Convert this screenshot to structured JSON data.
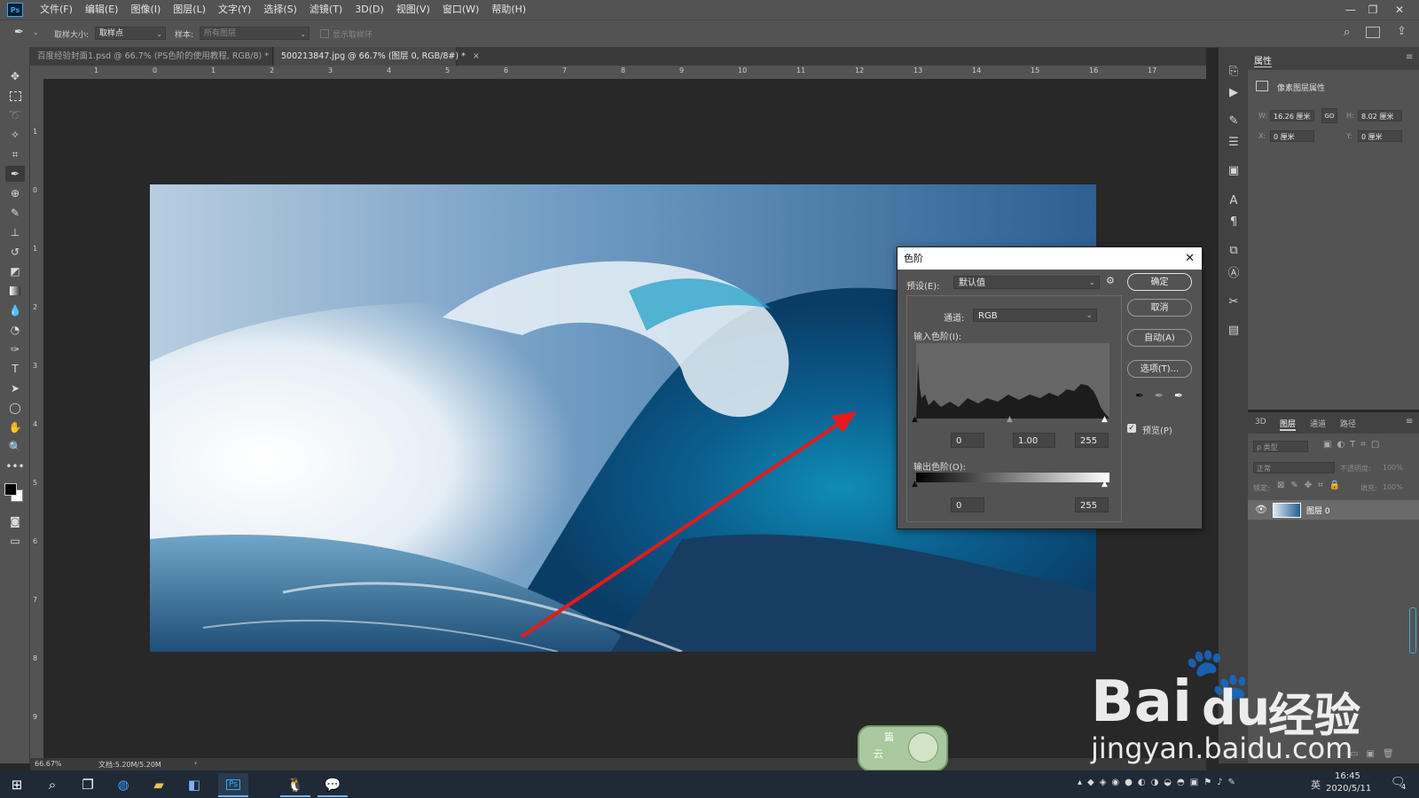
{
  "app": {
    "logo": "Ps"
  },
  "menubar": {
    "items": [
      "文件(F)",
      "编辑(E)",
      "图像(I)",
      "图层(L)",
      "文字(Y)",
      "选择(S)",
      "滤镜(T)",
      "3D(D)",
      "视图(V)",
      "窗口(W)",
      "帮助(H)"
    ],
    "window_controls": [
      "—",
      "❐",
      "✕"
    ]
  },
  "options_bar": {
    "tool_icon": "eyedropper-icon",
    "sample_size_label": "取样大小:",
    "sample_size_value": "取样点",
    "sample_label": "样本:",
    "sample_value": "所有图层",
    "show_ring_label": "显示取样环"
  },
  "tabs": [
    {
      "label": "百度经验封面1.psd @ 66.7% (PS色阶的使用教程, RGB/8) *",
      "close": "×"
    },
    {
      "label": "500213847.jpg @ 66.7% (图层 0, RGB/8#) *",
      "close": "×"
    }
  ],
  "ruler": {
    "h_labels": [
      "1",
      "0",
      "1",
      "2",
      "3",
      "4",
      "5",
      "6",
      "7",
      "8",
      "9",
      "10",
      "11",
      "12",
      "13",
      "14",
      "15",
      "16",
      "17"
    ],
    "v_labels": [
      "1",
      "0",
      "1",
      "2",
      "3",
      "4",
      "5",
      "6",
      "7",
      "8",
      "9"
    ]
  },
  "status": {
    "zoom": "66.67%",
    "doc": "文档:5.20M/5.20M",
    "arrow": "›"
  },
  "properties": {
    "tab": "属性",
    "kind": "像素图层属性",
    "w_label": "W:",
    "w_value": "16.26 厘米",
    "link": "GO",
    "h_label": "H:",
    "h_value": "8.02 厘米",
    "x_label": "X:",
    "x_value": "0 厘米",
    "y_label": "Y:",
    "y_value": "0 厘米"
  },
  "layers_panel": {
    "tabs": [
      "3D",
      "图层",
      "通道",
      "路径"
    ],
    "active_tab": "图层",
    "filter": "ρ 类型",
    "blend_mode": "正常",
    "opacity_label": "不透明度:",
    "opacity_value": "100%",
    "lock_label": "锁定:",
    "fill_label": "填充:",
    "fill_value": "100%",
    "layer_name": "图层 0"
  },
  "levels_dialog": {
    "title": "色阶",
    "preset_label": "预设(E):",
    "preset_value": "默认值",
    "channel_label": "通道:",
    "channel_value": "RGB",
    "input_label": "输入色阶(I):",
    "input_black": "0",
    "input_gamma": "1.00",
    "input_white": "255",
    "output_label": "输出色阶(O):",
    "output_black": "0",
    "output_white": "255",
    "ok": "确定",
    "cancel": "取消",
    "auto": "自动(A)",
    "options": "选项(T)...",
    "preview_label": "预览(P)",
    "preview_checked": true
  },
  "taskbar": {
    "time": "16:45",
    "date": "2020/5/11",
    "ime": "英",
    "notification_count": "4",
    "ps_label": "Ps"
  },
  "watermark": {
    "brand": "Bai",
    "brand_du": "du",
    "brand_cn": "经验",
    "url": "jingyan.baidu.com"
  },
  "badge": {
    "line1": "篇",
    "line2": "云"
  },
  "colors": {
    "ps_blue": "#31a8ff",
    "arrow": "#e8191c",
    "watermark": "#ffffff"
  }
}
